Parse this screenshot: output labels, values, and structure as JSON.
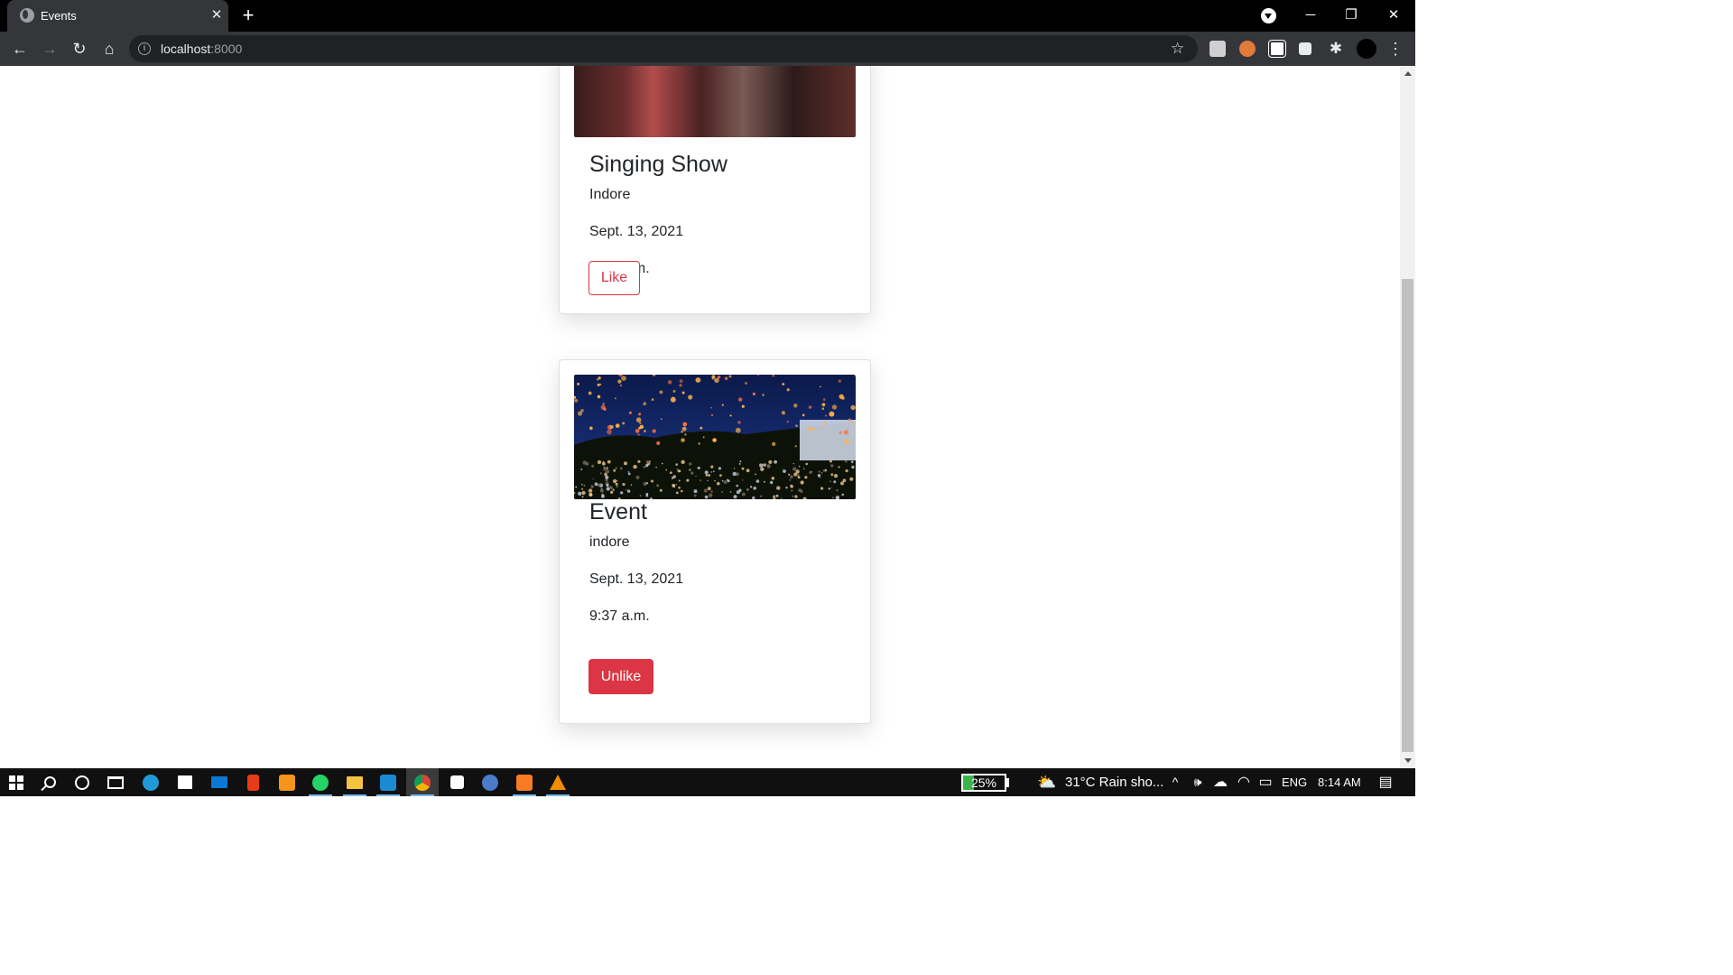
{
  "browser": {
    "tab": {
      "title": "Events",
      "close": "✕"
    },
    "new_tab": "+",
    "window": {
      "minimize": "─",
      "restore": "❐",
      "close": "✕"
    },
    "nav": {
      "back": "←",
      "forward": "→",
      "reload": "↻",
      "home": "⌂"
    },
    "address": {
      "host": "localhost",
      "port": ":8000",
      "info": "i"
    },
    "bookmark": "☆",
    "extensions_icon": "✱",
    "menu": "⋮",
    "colors": {
      "frame": "#000000",
      "toolbar": "#35363a",
      "omnibox": "#202124"
    }
  },
  "events": [
    {
      "title": "Singing Show",
      "location": "Indore",
      "date": "Sept. 13, 2021",
      "time": "6:37 a.m.",
      "button": "Like",
      "liked": false
    },
    {
      "title": "Event",
      "location": "indore",
      "date": "Sept. 13, 2021",
      "time": "9:37 a.m.",
      "button": "Unlike",
      "liked": true
    }
  ],
  "theme": {
    "danger": "#dc3545",
    "text": "#212529"
  },
  "taskbar": {
    "battery": {
      "percent_label": "25%",
      "level": 0.25
    },
    "weather": "31°C  Rain sho...",
    "language": "ENG",
    "time": "8:14 AM",
    "tray": {
      "chevron": "^",
      "volume": "🕪",
      "cloud": "☁",
      "wifi": "◠",
      "battery": "▭",
      "notifications": "▤"
    }
  }
}
